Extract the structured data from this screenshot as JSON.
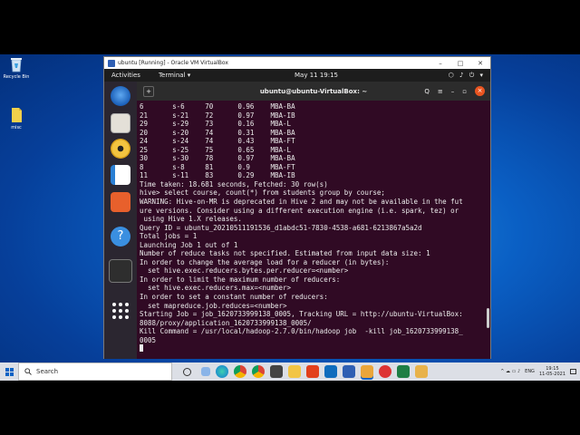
{
  "desktop": {
    "icons": [
      {
        "label": "Recycle Bin"
      },
      {
        "label": "misc"
      }
    ]
  },
  "vbox": {
    "title": "ubuntu [Running] - Oracle VM VirtualBox",
    "controls": {
      "minimize": "–",
      "maximize": "□",
      "close": "✕"
    }
  },
  "ubuntu": {
    "activities": "Activities",
    "app_menu": "Terminal ▾",
    "clock": "May 11  19:15",
    "sys_icons": "⬡ ♪ ⏻ ▾"
  },
  "terminal": {
    "title": "ubuntu@ubuntu-VirtualBox: ~",
    "header_icons": {
      "search": "Q",
      "menu": "≡",
      "minimize": "–",
      "maximize": "▫",
      "close": "×"
    },
    "lines": [
      "6       s-6     70      0.96    MBA-BA",
      "21      s-21    72      0.97    MBA-IB",
      "29      s-29    73      0.16    MBA-L",
      "20      s-20    74      0.31    MBA-BA",
      "24      s-24    74      0.43    MBA-FT",
      "25      s-25    75      0.65    MBA-L",
      "30      s-30    78      0.97    MBA-BA",
      "8       s-8     81      0.9     MBA-FT",
      "11      s-11    83      0.29    MBA-IB",
      "Time taken: 18.681 seconds, Fetched: 30 row(s)",
      "hive> select course, count(*) from students group by course;",
      "WARNING: Hive-on-MR is deprecated in Hive 2 and may not be available in the fut",
      "ure versions. Consider using a different execution engine (i.e. spark, tez) or",
      " using Hive 1.X releases.",
      "Query ID = ubuntu_20210511191536_d1abdc51-7830-4538-a681-6213867a5a2d",
      "Total jobs = 1",
      "Launching Job 1 out of 1",
      "Number of reduce tasks not specified. Estimated from input data size: 1",
      "In order to change the average load for a reducer (in bytes):",
      "  set hive.exec.reducers.bytes.per.reducer=<number>",
      "In order to limit the maximum number of reducers:",
      "  set hive.exec.reducers.max=<number>",
      "In order to set a constant number of reducers:",
      "  set mapreduce.job.reduces=<number>",
      "Starting Job = job_1620733999138_0005, Tracking URL = http://ubuntu-VirtualBox:",
      "8088/proxy/application_1620733999138_0005/",
      "Kill Command = /usr/local/hadoop-2.7.0/bin/hadoop job  -kill job_1620733999138_",
      "0005"
    ]
  },
  "taskbar": {
    "search_placeholder": "Search",
    "tray_lang": "ENG",
    "time": "19:15",
    "date": "11-05-2021",
    "tray_icons": "^ ☁ ▭ ♪"
  },
  "colors": {
    "terminal_bg": "#300a24",
    "ubuntu_orange": "#e95420",
    "desktop_blue": "#0a5fc4"
  }
}
